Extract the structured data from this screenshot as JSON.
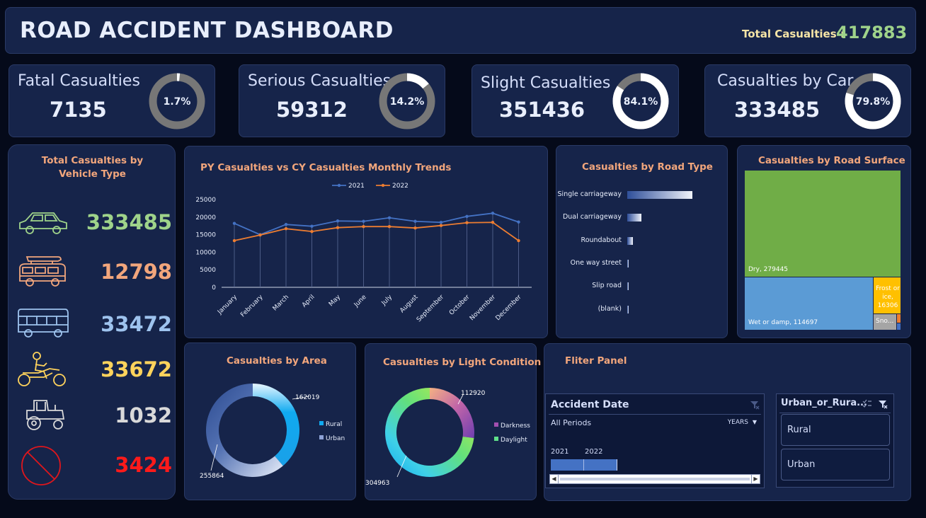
{
  "header": {
    "title": "ROAD ACCIDENT DASHBOARD",
    "total_label": "Total Casualties :",
    "total_value": "417883"
  },
  "kpis": [
    {
      "title": "Fatal Casualties",
      "value": "7135",
      "pct": 1.7,
      "pct_label": "1.7%"
    },
    {
      "title": "Serious Casualties",
      "value": "59312",
      "pct": 14.2,
      "pct_label": "14.2%"
    },
    {
      "title": "Slight Casualties",
      "value": "351436",
      "pct": 84.1,
      "pct_label": "84.1%"
    },
    {
      "title": "Casualties by Car",
      "value": "333485",
      "pct": 79.8,
      "pct_label": "79.8%"
    }
  ],
  "vehicle_panel": {
    "title1": "Total Casualties by",
    "title2": "Vehicle Type",
    "rows": [
      {
        "icon": "car-icon",
        "value": "333485",
        "color": "#9fd38a"
      },
      {
        "icon": "van-icon",
        "value": "12798",
        "color": "#f2a67c"
      },
      {
        "icon": "bus-icon",
        "value": "33472",
        "color": "#9ec3ee"
      },
      {
        "icon": "motorcycle-icon",
        "value": "33672",
        "color": "#ffd35c"
      },
      {
        "icon": "tractor-icon",
        "value": "1032",
        "color": "#d9d9d9"
      },
      {
        "icon": "prohibited-icon",
        "value": "3424",
        "color": "#ff1a1a"
      }
    ]
  },
  "trend": {
    "title": "PY Casualties vs CY Casualties Monthly Trends",
    "legend": [
      "2021",
      "2022"
    ]
  },
  "road_type": {
    "title": "Casualties by Road Type",
    "categories": [
      "Single carriageway",
      "Dual carriageway",
      "Roundabout",
      "One way street",
      "Slip road",
      "(blank)"
    ]
  },
  "surface": {
    "title": "Casualties by Road Surface",
    "dry_label": "Dry, 279445",
    "wet_label": "Wet or damp, 114697",
    "frost_label": "Frost or ice, 16306",
    "snow_label": "Sno..."
  },
  "area": {
    "title": "Casualties by Area",
    "legend": [
      "Rural",
      "Urban"
    ],
    "rural_value": "162019",
    "urban_value": "255864"
  },
  "light": {
    "title": "Casualties by Light Condition",
    "legend": [
      "Darkness",
      "Daylight"
    ],
    "darkness_value": "112920",
    "daylight_value": "304963"
  },
  "filter": {
    "title": "Fliter Panel",
    "date_slicer": {
      "title": "Accident Date",
      "periods": "All Periods",
      "unit": "YEARS",
      "year1": "2021",
      "year2": "2022"
    },
    "area_slicer": {
      "title": "Urban_or_Rura...",
      "options": [
        "Rural",
        "Urban"
      ]
    }
  },
  "chart_data": [
    {
      "type": "line",
      "title": "PY Casualties vs CY Casualties Monthly Trends",
      "categories": [
        "January",
        "February",
        "March",
        "April",
        "May",
        "June",
        "July",
        "August",
        "September",
        "October",
        "November",
        "December"
      ],
      "series": [
        {
          "name": "2021",
          "values": [
            18200,
            15000,
            17900,
            17400,
            18900,
            18800,
            19800,
            18800,
            18500,
            20200,
            21100,
            18600
          ],
          "color": "#4472c4"
        },
        {
          "name": "2022",
          "values": [
            13300,
            14900,
            16700,
            15900,
            17000,
            17300,
            17300,
            16900,
            17600,
            18400,
            18500,
            13300
          ],
          "color": "#ed7d31"
        }
      ],
      "ylim": [
        0,
        25000
      ],
      "yticks": [
        "0",
        "5000",
        "10000",
        "15000",
        "20000",
        "25000"
      ],
      "legend": "top"
    },
    {
      "type": "bar",
      "title": "Casualties by Road Type",
      "orientation": "horizontal",
      "categories": [
        "Single carriageway",
        "Dual carriageway",
        "Roundabout",
        "One way street",
        "Slip road",
        "(blank)"
      ],
      "values": [
        310000,
        67000,
        26000,
        7000,
        4500,
        3000
      ]
    },
    {
      "type": "treemap",
      "title": "Casualties by Road Surface",
      "categories": [
        "Dry",
        "Wet or damp",
        "Frost or ice",
        "Snow",
        "Flood"
      ],
      "values": [
        279445,
        114697,
        16306,
        5000,
        1000
      ]
    },
    {
      "type": "pie",
      "title": "Casualties by Area",
      "categories": [
        "Rural",
        "Urban"
      ],
      "values": [
        162019,
        255864
      ]
    },
    {
      "type": "pie",
      "title": "Casualties by Light Condition",
      "categories": [
        "Darkness",
        "Daylight"
      ],
      "values": [
        112920,
        304963
      ]
    }
  ]
}
